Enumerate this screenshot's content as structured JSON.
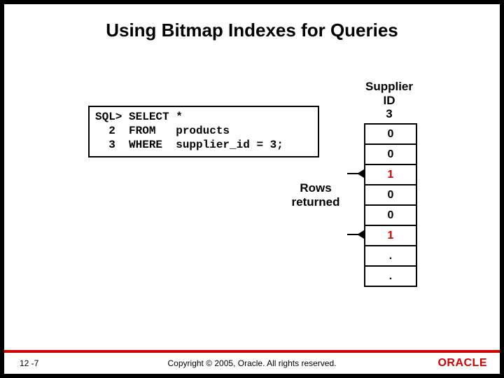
{
  "title": "Using Bitmap Indexes for Queries",
  "sql": {
    "line1": "SQL> SELECT *",
    "line2": "  2  FROM   products",
    "line3": "  3  WHERE  supplier_id = 3;"
  },
  "bitmap": {
    "header_line1": "Supplier",
    "header_line2": "ID",
    "header_line3": "3",
    "cells": [
      "0",
      "0",
      "1",
      "0",
      "0",
      "1",
      ".",
      "."
    ]
  },
  "rows_label_line1": "Rows",
  "rows_label_line2": "returned",
  "footer": {
    "page": "12 -7",
    "copyright": "Copyright © 2005, Oracle. All rights reserved.",
    "logo": "ORACLE"
  }
}
